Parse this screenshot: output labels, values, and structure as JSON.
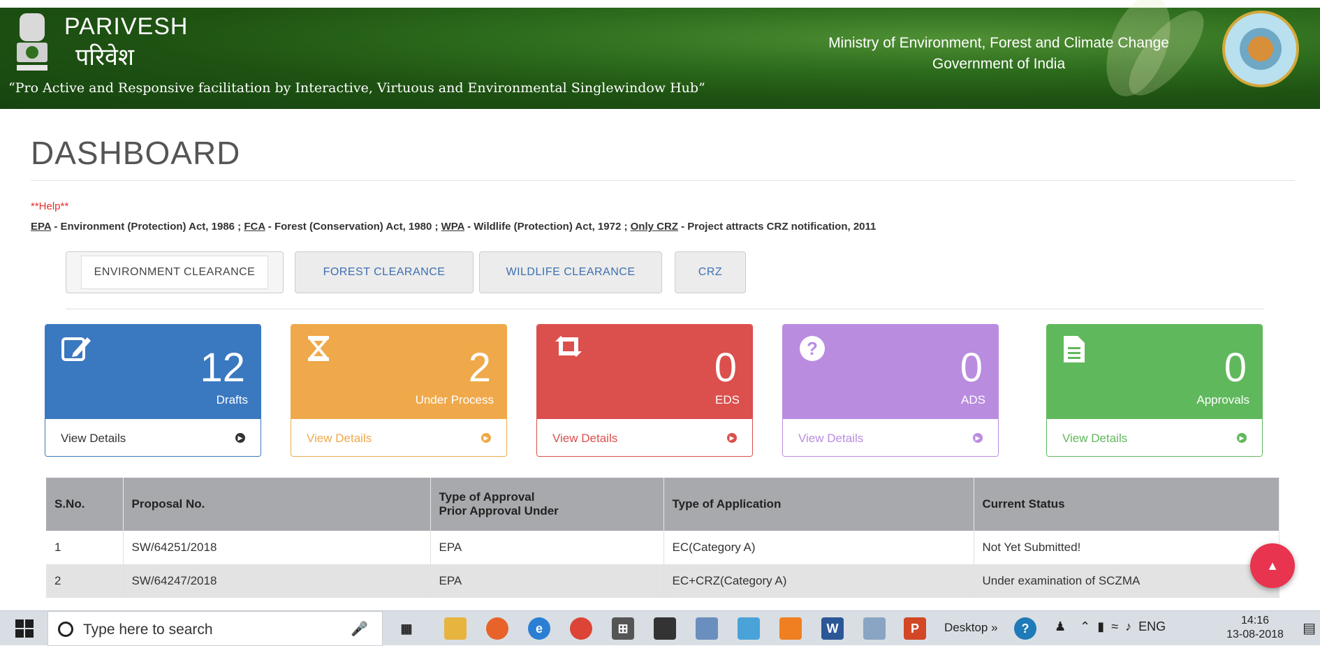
{
  "header": {
    "brand_en": "PARIVESH",
    "brand_hi": "परिवेश",
    "tagline": "“Pro Active and Responsive facilitation by Interactive, Virtuous and Environmental Singlewindow Hub”",
    "ministry_line1": "Ministry of Environment, Forest and Climate Change",
    "ministry_line2": "Government of India",
    "emblem_icon": "national-emblem-icon",
    "logo_icon": "ministry-logo-icon"
  },
  "page": {
    "title": "DASHBOARD",
    "help_label": "**Help**",
    "acts": [
      {
        "abbr": "EPA",
        "text": " - Environment (Protection) Act, 1986 ; "
      },
      {
        "abbr": "FCA",
        "text": " - Forest (Conservation) Act, 1980 ; "
      },
      {
        "abbr": "WPA",
        "text": " - Wildlife (Protection) Act, 1972 ; "
      },
      {
        "abbr": "Only CRZ",
        "text": " - Project attracts CRZ notification, 2011"
      }
    ]
  },
  "tabs": [
    {
      "label": "ENVIRONMENT CLEARANCE",
      "active": true
    },
    {
      "label": "FOREST CLEARANCE",
      "active": false
    },
    {
      "label": "WILDLIFE CLEARANCE",
      "active": false
    },
    {
      "label": "CRZ",
      "active": false
    }
  ],
  "cards": [
    {
      "count": "12",
      "label": "Drafts",
      "link": "View Details",
      "color": "#3a78c0",
      "icon": "edit-icon"
    },
    {
      "count": "2",
      "label": "Under Process",
      "link": "View Details",
      "color": "#efa94a",
      "icon": "hourglass-icon"
    },
    {
      "count": "0",
      "label": "EDS",
      "link": "View Details",
      "color": "#db4f4c",
      "icon": "retweet-icon"
    },
    {
      "count": "0",
      "label": "ADS",
      "link": "View Details",
      "color": "#b98ce0",
      "icon": "question-icon"
    },
    {
      "count": "0",
      "label": "Approvals",
      "link": "View Details",
      "color": "#60b85c",
      "icon": "document-icon"
    }
  ],
  "table": {
    "headers": [
      "S.No.",
      "Proposal No.",
      "Type of Approval",
      "Prior Approval Under",
      "Type of Application",
      "Current Status"
    ],
    "rows": [
      {
        "sno": "1",
        "proposal": "SW/64251/2018",
        "approval": "EPA",
        "application": "EC(Category A)",
        "status": "Not Yet Submitted!"
      },
      {
        "sno": "2",
        "proposal": "SW/64247/2018",
        "approval": "EPA",
        "application": "EC+CRZ(Category A)",
        "status": "Under examination of SCZMA"
      }
    ]
  },
  "taskbar": {
    "search_placeholder": "Type here to search",
    "desktop_label": "Desktop",
    "language": "ENG",
    "time": "14:16",
    "date": "13-08-2018"
  }
}
